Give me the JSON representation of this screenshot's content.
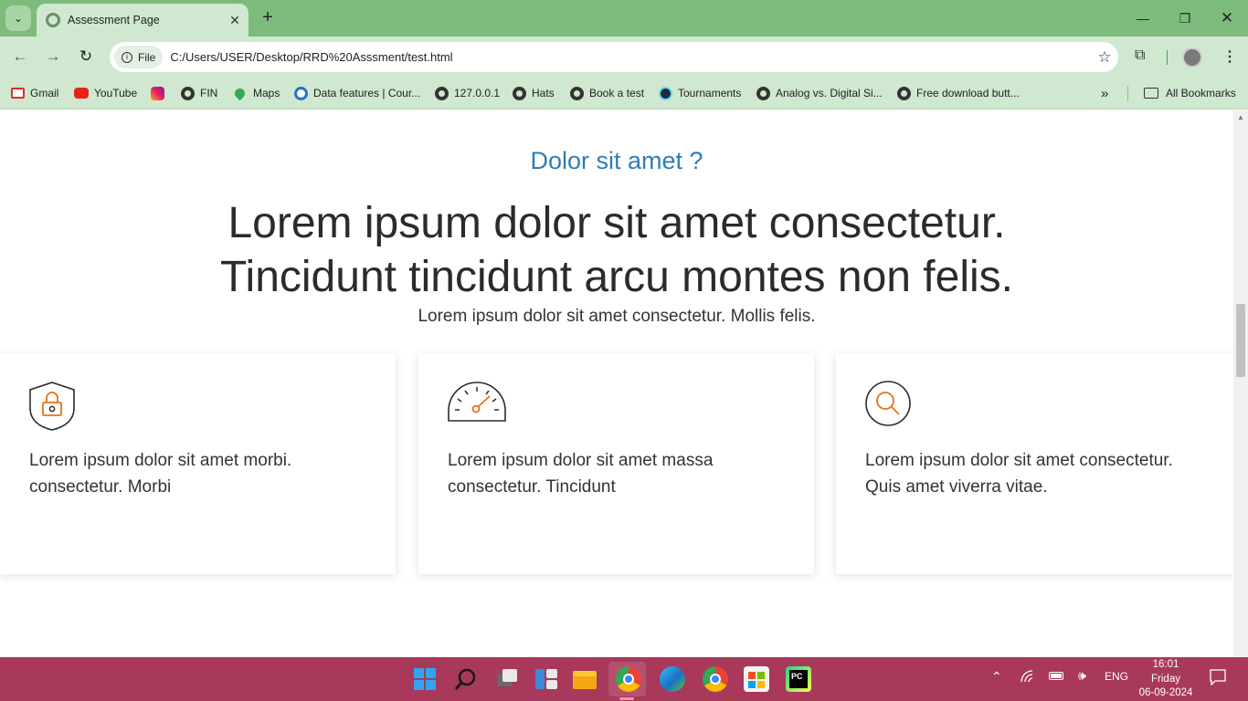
{
  "browser": {
    "tab_title": "Assessment Page",
    "site_chip_label": "File",
    "url": "C:/Users/USER/Desktop/RRD%20Asssment/test.html",
    "bookmarks": [
      {
        "label": "Gmail",
        "icon": "gmail-icon"
      },
      {
        "label": "YouTube",
        "icon": "youtube-icon"
      },
      {
        "label": "",
        "icon": "instagram-icon"
      },
      {
        "label": "FIN",
        "icon": "globe-icon"
      },
      {
        "label": "Maps",
        "icon": "maps-icon"
      },
      {
        "label": "Data features | Cour...",
        "icon": "coursera-icon"
      },
      {
        "label": "127.0.0.1",
        "icon": "globe-icon"
      },
      {
        "label": "Hats",
        "icon": "globe-icon"
      },
      {
        "label": "Book a test",
        "icon": "globe-icon"
      },
      {
        "label": "Tournaments",
        "icon": "react-icon"
      },
      {
        "label": "Analog vs. Digital Si...",
        "icon": "globe-icon"
      },
      {
        "label": "Free download butt...",
        "icon": "globe-icon"
      }
    ],
    "more_bookmarks_label": "»",
    "all_bookmarks_label": "All Bookmarks"
  },
  "page": {
    "eyebrow": "Dolor sit amet ?",
    "headline_line1": "Lorem ipsum dolor sit amet consectetur.",
    "headline_line2": "Tincidunt tincidunt arcu montes non felis.",
    "subtext": "Lorem ipsum dolor sit amet consectetur. Mollis felis.",
    "cards": [
      {
        "icon": "shield-lock-icon",
        "line1": "Lorem ipsum dolor sit amet morbi.",
        "line2": "consectetur. Morbi"
      },
      {
        "icon": "speedometer-icon",
        "line1": "Lorem ipsum dolor sit amet massa",
        "line2": "consectetur. Tincidunt"
      },
      {
        "icon": "magnifier-icon",
        "line1": "Lorem ipsum dolor sit amet consectetur.",
        "line2": "Quis amet viverra vitae."
      }
    ],
    "colors": {
      "accent": "#2f7db6",
      "icon_orange": "#e8701a",
      "text": "#2b2b2b"
    }
  },
  "taskbar": {
    "apps": [
      "windows-start-icon",
      "search-icon",
      "task-view-icon",
      "widgets-icon",
      "file-explorer-icon",
      "chrome-icon",
      "edge-icon",
      "chrome-profile-icon",
      "microsoft-store-icon",
      "pycharm-icon"
    ],
    "language": "ENG",
    "time": "16:01",
    "day": "Friday",
    "date": "06-09-2024",
    "color": "#a8395b"
  }
}
